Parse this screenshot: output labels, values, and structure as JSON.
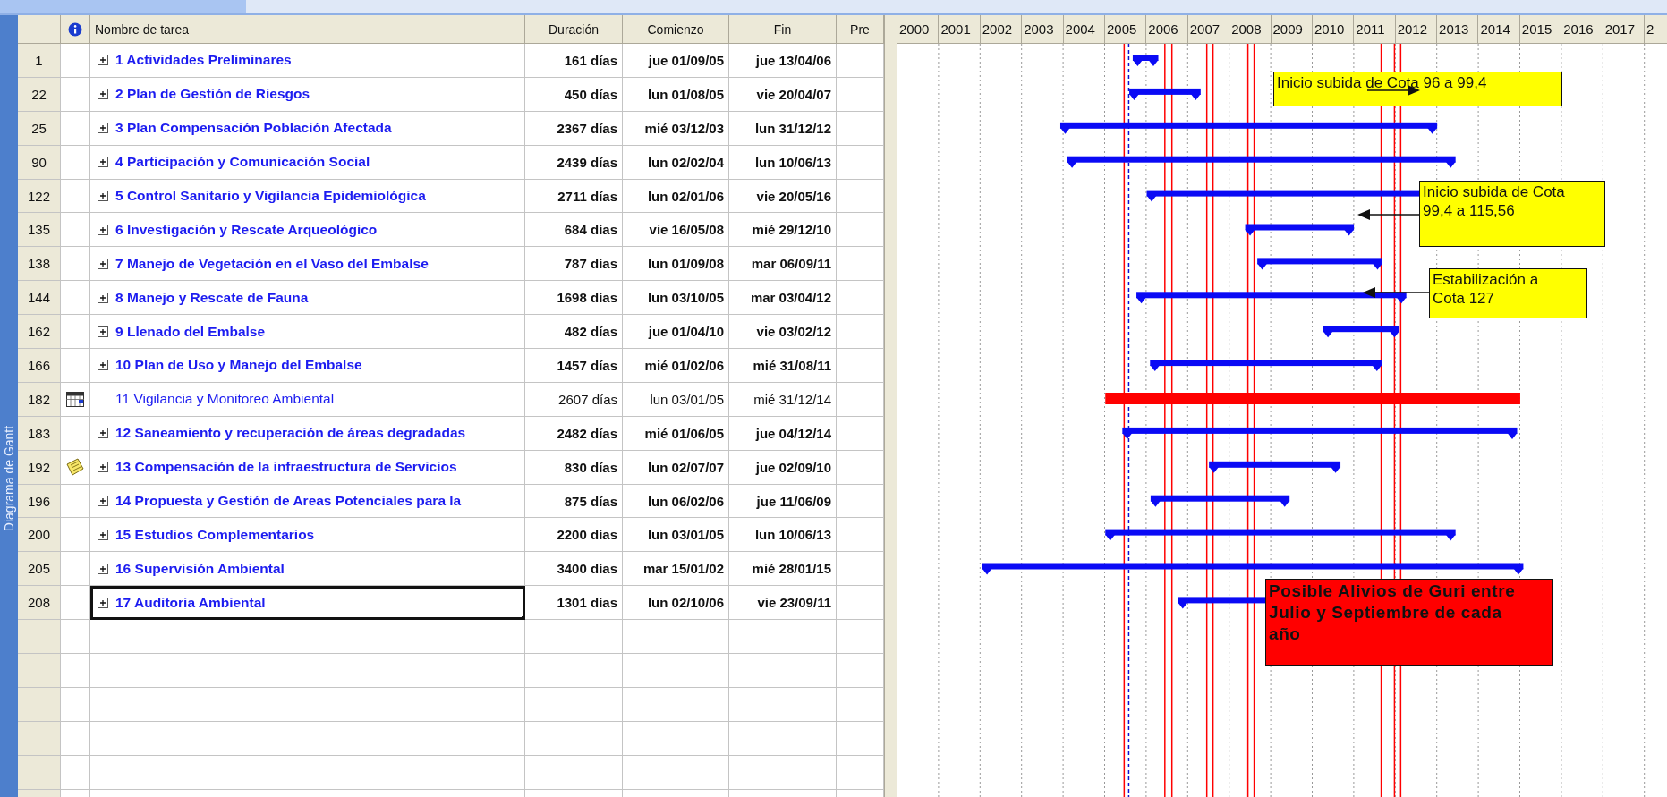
{
  "view_bar": {
    "label": "Diagrama de Gantt"
  },
  "table": {
    "columns": [
      "Nombre de tarea",
      "Duración",
      "Comienzo",
      "Fin",
      "Pre"
    ],
    "rows": [
      {
        "id": "1",
        "kind": "summary",
        "name": "1 Actividades Preliminares",
        "duration": "161 días",
        "start": "jue 01/09/05",
        "finish": "jue 13/04/06",
        "selected": false
      },
      {
        "id": "22",
        "kind": "summary",
        "name": "2 Plan de Gestión de Riesgos",
        "duration": "450 días",
        "start": "lun 01/08/05",
        "finish": "vie 20/04/07",
        "selected": false
      },
      {
        "id": "25",
        "kind": "summary",
        "name": "3 Plan Compensación Población Afectada",
        "duration": "2367 días",
        "start": "mié 03/12/03",
        "finish": "lun 31/12/12",
        "selected": false
      },
      {
        "id": "90",
        "kind": "summary",
        "name": "4 Participación y Comunicación Social",
        "duration": "2439 días",
        "start": "lun 02/02/04",
        "finish": "lun 10/06/13",
        "selected": false
      },
      {
        "id": "122",
        "kind": "summary",
        "name": "5 Control Sanitario y Vigilancia Epidemiológica",
        "duration": "2711 días",
        "start": "lun 02/01/06",
        "finish": "vie 20/05/16",
        "selected": false
      },
      {
        "id": "135",
        "kind": "summary",
        "name": "6 Investigación y Rescate Arqueológico",
        "duration": "684 días",
        "start": "vie 16/05/08",
        "finish": "mié 29/12/10",
        "selected": false
      },
      {
        "id": "138",
        "kind": "summary",
        "name": "7 Manejo de Vegetación en el Vaso del Embalse",
        "duration": "787 días",
        "start": "lun 01/09/08",
        "finish": "mar 06/09/11",
        "selected": false
      },
      {
        "id": "144",
        "kind": "summary",
        "name": "8  Manejo y Rescate de Fauna",
        "duration": "1698 días",
        "start": "lun 03/10/05",
        "finish": "mar 03/04/12",
        "selected": false
      },
      {
        "id": "162",
        "kind": "summary",
        "name": "9 Llenado del Embalse",
        "duration": "482 días",
        "start": "jue 01/04/10",
        "finish": "vie 03/02/12",
        "selected": false
      },
      {
        "id": "166",
        "kind": "summary",
        "name": "10 Plan de Uso y Manejo del Embalse",
        "duration": "1457 días",
        "start": "mié 01/02/06",
        "finish": "mié 31/08/11",
        "selected": false
      },
      {
        "id": "182",
        "kind": "task",
        "indicator": {
          "kind": "calendar"
        },
        "name": "11 Vigilancia y Monitoreo Ambiental",
        "duration": "2607 días",
        "start": "lun 03/01/05",
        "finish": "mié 31/12/14",
        "selected": false
      },
      {
        "id": "183",
        "kind": "summary",
        "name": "12 Saneamiento y recuperación de áreas degradadas",
        "duration": "2482 días",
        "start": "mié 01/06/05",
        "finish": "jue 04/12/14",
        "selected": false
      },
      {
        "id": "192",
        "kind": "summary",
        "indicator": {
          "kind": "note"
        },
        "name": "13 Compensación de la infraestructura de Servicios",
        "duration": "830 días",
        "start": "lun 02/07/07",
        "finish": "jue 02/09/10",
        "selected": false
      },
      {
        "id": "196",
        "kind": "summary",
        "name": "14 Propuesta y Gestión de Areas Potenciales para la",
        "duration": "875 días",
        "start": "lun 06/02/06",
        "finish": "jue 11/06/09",
        "selected": false
      },
      {
        "id": "200",
        "kind": "summary",
        "name": "15 Estudios Complementarios",
        "duration": "2200 días",
        "start": "lun 03/01/05",
        "finish": "lun 10/06/13",
        "selected": false
      },
      {
        "id": "205",
        "kind": "summary",
        "name": "16 Supervisión Ambiental",
        "duration": "3400 días",
        "start": "mar 15/01/02",
        "finish": "mié 28/01/15",
        "selected": false
      },
      {
        "id": "208",
        "kind": "summary",
        "name": "17 Auditoria Ambiental",
        "duration": "1301 días",
        "start": "lun 02/10/06",
        "finish": "vie 23/09/11",
        "selected": true
      }
    ]
  },
  "gantt": {
    "years": [
      "2000",
      "2001",
      "2002",
      "2003",
      "2004",
      "2005",
      "2006",
      "2007",
      "2008",
      "2009",
      "2010",
      "2011",
      "2012",
      "2013",
      "2014",
      "2015",
      "2016",
      "2017",
      "2"
    ],
    "callouts": [
      {
        "text": "Inicio subida de Cota 96 a 99,4",
        "color": "#ffff00"
      },
      {
        "text": "Inicio subida de Cota 99,4 a 115,56",
        "color": "#ffff00"
      },
      {
        "text": "Estabilización a Cota 127",
        "color": "#ffff00"
      },
      {
        "text": "Posible Alivios de Guri entre Julio y Septiembre de cada año",
        "color": "#ff0000"
      }
    ]
  }
}
